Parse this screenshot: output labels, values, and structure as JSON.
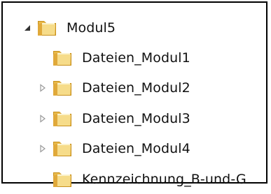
{
  "tree": {
    "root": {
      "label": "Modul5",
      "expanded": true,
      "icon": "folder-icon"
    },
    "children": [
      {
        "label": "Dateien_Modul1",
        "has_children": false,
        "icon": "folder-icon"
      },
      {
        "label": "Dateien_Modul2",
        "has_children": true,
        "icon": "folder-icon"
      },
      {
        "label": "Dateien_Modul3",
        "has_children": true,
        "icon": "folder-icon"
      },
      {
        "label": "Dateien_Modul4",
        "has_children": true,
        "icon": "folder-icon"
      },
      {
        "label": "Kennzeichnung_B-und-G",
        "has_children": false,
        "icon": "folder-icon"
      }
    ]
  },
  "colors": {
    "folder_light": "#f6dc8a",
    "folder_mid": "#e8b94a",
    "folder_dark": "#c8901c",
    "expander_collapsed": "#9a9a9a",
    "expander_expanded": "#333333",
    "frame_border": "#000000"
  }
}
